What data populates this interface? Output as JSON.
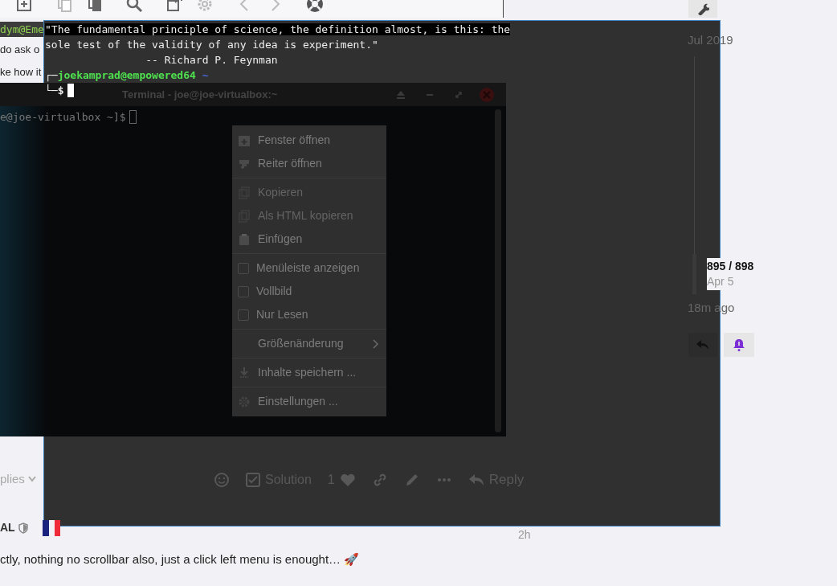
{
  "post": {
    "screenshot_strip": "dym@Eme",
    "lines": [
      "do ask o",
      "ke how it"
    ],
    "embedded_terminal": {
      "title": "Terminal - joe@joe-virtualbox:~",
      "prompt": "e@joe-virtualbox ~]$",
      "menu": [
        {
          "kind": "item",
          "label": "Fenster öffnen",
          "disabled": false
        },
        {
          "kind": "item",
          "label": "Reiter öffnen",
          "disabled": false
        },
        {
          "kind": "separator"
        },
        {
          "kind": "item",
          "label": "Kopieren",
          "disabled": true
        },
        {
          "kind": "item",
          "label": "Als HTML kopieren",
          "disabled": true
        },
        {
          "kind": "item",
          "label": "Einfügen",
          "disabled": false
        },
        {
          "kind": "separator"
        },
        {
          "kind": "check",
          "label": "Menüleiste anzeigen",
          "checked": false
        },
        {
          "kind": "check",
          "label": "Vollbild",
          "checked": false
        },
        {
          "kind": "check",
          "label": "Nur Lesen",
          "checked": false
        },
        {
          "kind": "separator"
        },
        {
          "kind": "submenu",
          "label": "Größenänderung"
        },
        {
          "kind": "separator"
        },
        {
          "kind": "item",
          "label": "Inhalte speichern ...",
          "disabled": false
        },
        {
          "kind": "separator"
        },
        {
          "kind": "item",
          "label": "Einstellungen ...",
          "disabled": false
        }
      ]
    },
    "replies_toggle": "plies",
    "actions": {
      "solution": "Solution",
      "like_count": "1",
      "reply": "Reply"
    }
  },
  "reply_post": {
    "author": "AL",
    "time": "2h",
    "text": "ctly, nothing no scrollbar also, just a click left menu is enought… 🚀"
  },
  "timeline": {
    "start": "Jul 2019",
    "position": "895 / 898",
    "date": "Apr 5",
    "last": "18m ago"
  },
  "terminal": {
    "lines": [
      {
        "kind": "quote",
        "text": "\"The fundamental principle of science, the definition almost, is this: the",
        "highlighted": true
      },
      {
        "kind": "quote",
        "text": "sole test of the validity of any idea is experiment.\"",
        "highlighted": false
      },
      {
        "kind": "author",
        "text": "-- Richard P. Feynman",
        "highlighted": false
      }
    ],
    "corner_top": "┌─",
    "user": "joekamprad@empowered64",
    "path": " ~",
    "corner_bottom": "└─",
    "prompt": "$"
  }
}
